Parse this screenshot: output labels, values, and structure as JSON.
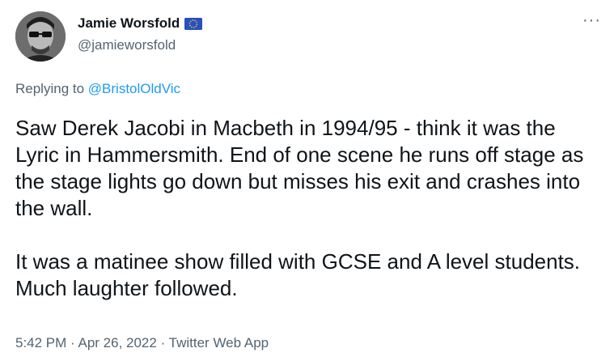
{
  "author": {
    "display_name": "Jamie Worsfold",
    "handle": "@jamieworsfold",
    "flag_icon": "eu-flag-icon"
  },
  "more_icon": "···",
  "reply": {
    "prefix": "Replying to ",
    "to": "@BristolOldVic"
  },
  "tweet": {
    "paragraphs": [
      "Saw Derek Jacobi in Macbeth in 1994/95 - think it was the Lyric in Hammersmith. End of one scene he runs off stage as the stage lights go down but misses his exit and crashes into the wall.",
      "It was a matinee show filled with GCSE and A level students. Much laughter followed."
    ]
  },
  "meta": {
    "time": "5:42 PM",
    "sep1": " · ",
    "date": "Apr 26, 2022",
    "sep2": " · ",
    "app": "Twitter Web App"
  },
  "colors": {
    "text": "#0f1419",
    "secondary": "#536471",
    "link": "#1d9bf0",
    "flag": "#2a4fbf"
  }
}
